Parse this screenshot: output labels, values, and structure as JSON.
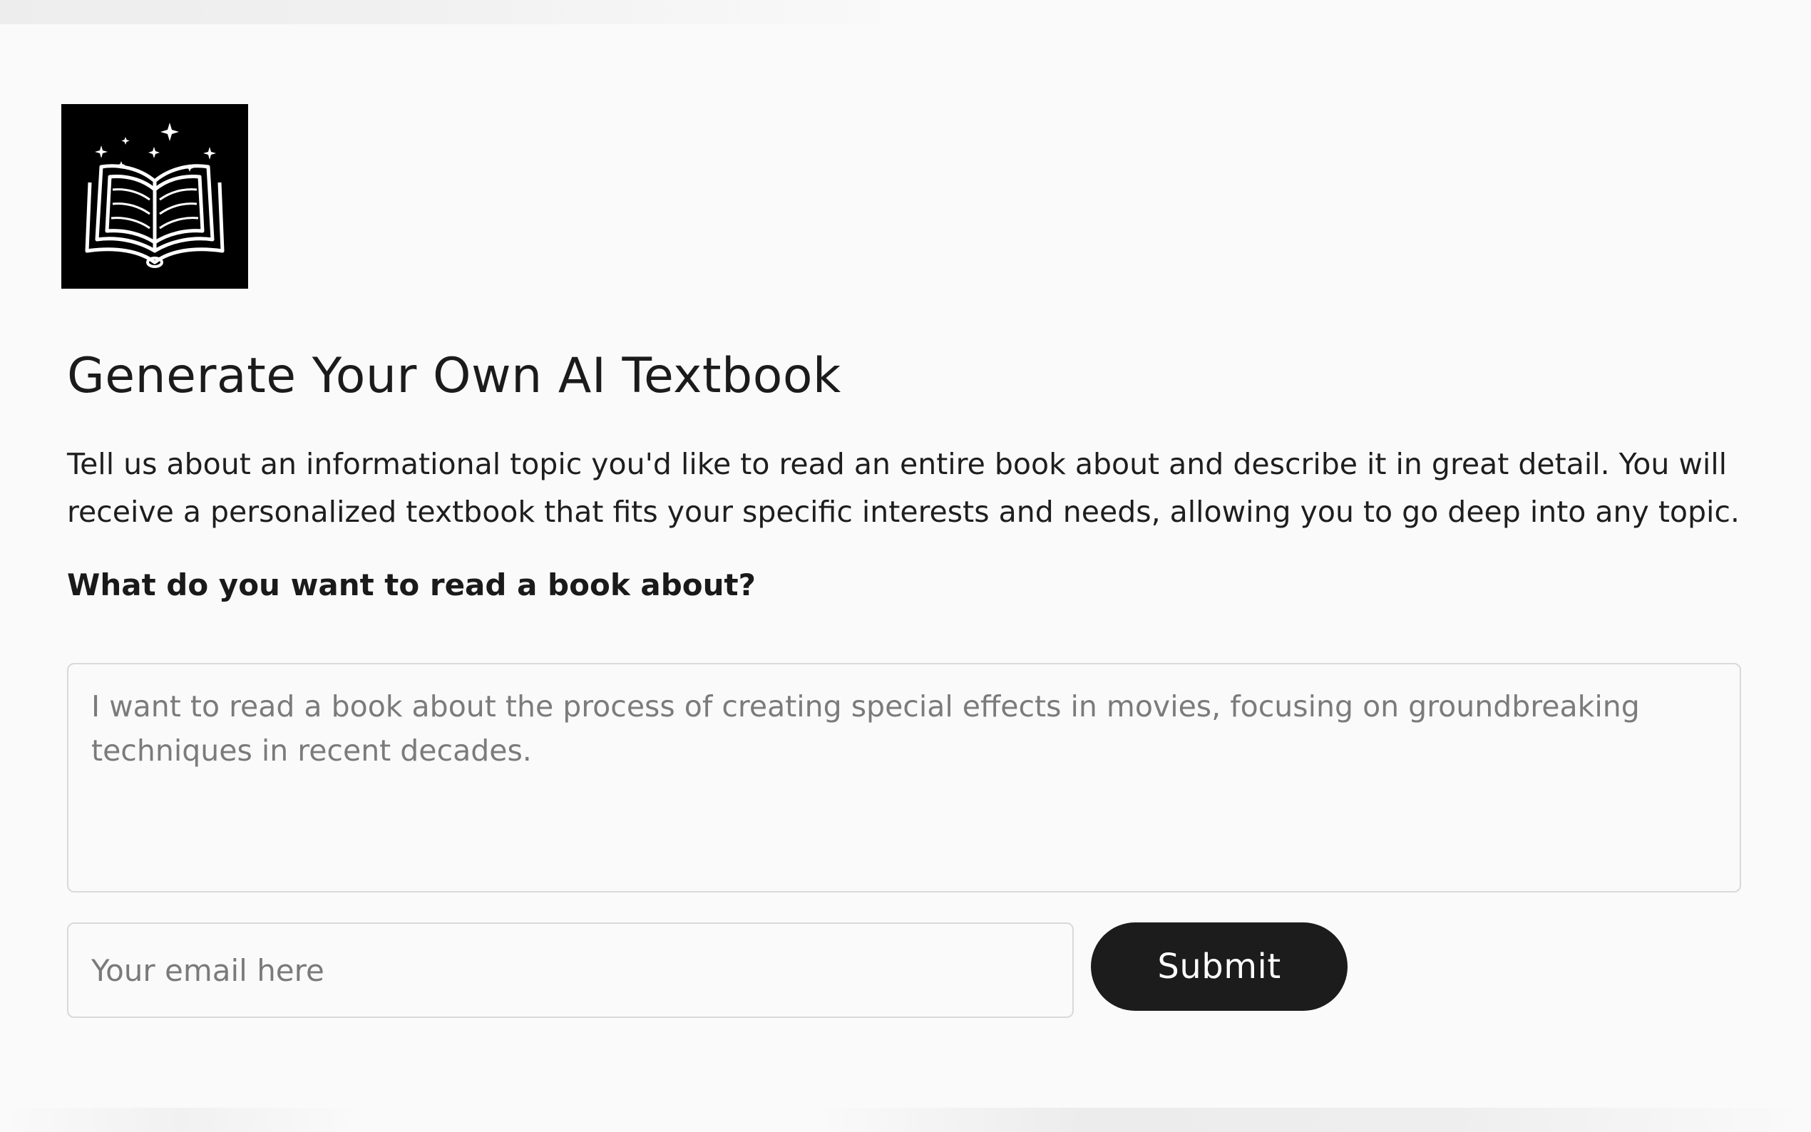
{
  "logo": {
    "icon": "open-book-with-sparkles-icon"
  },
  "header": {
    "title": "Generate Your Own AI Textbook"
  },
  "intro": {
    "description": "Tell us about an informational topic you'd like to read an entire book about and describe it in great detail. You will receive a personalized textbook that fits your specific interests and needs, allowing you to go deep into any topic."
  },
  "form": {
    "question_label": "What do you want to read a book about?",
    "topic_placeholder": "I want to read a book about the process of creating special effects in movies, focusing on groundbreaking techniques in recent decades.",
    "topic_value": "",
    "email_placeholder": "Your email here",
    "email_value": "",
    "submit_label": "Submit"
  },
  "colors": {
    "background": "#fafafa",
    "button": "#1c1c1c",
    "button_text": "#ffffff",
    "placeholder_text": "#7b7b7b",
    "border": "#d9d9d9"
  }
}
